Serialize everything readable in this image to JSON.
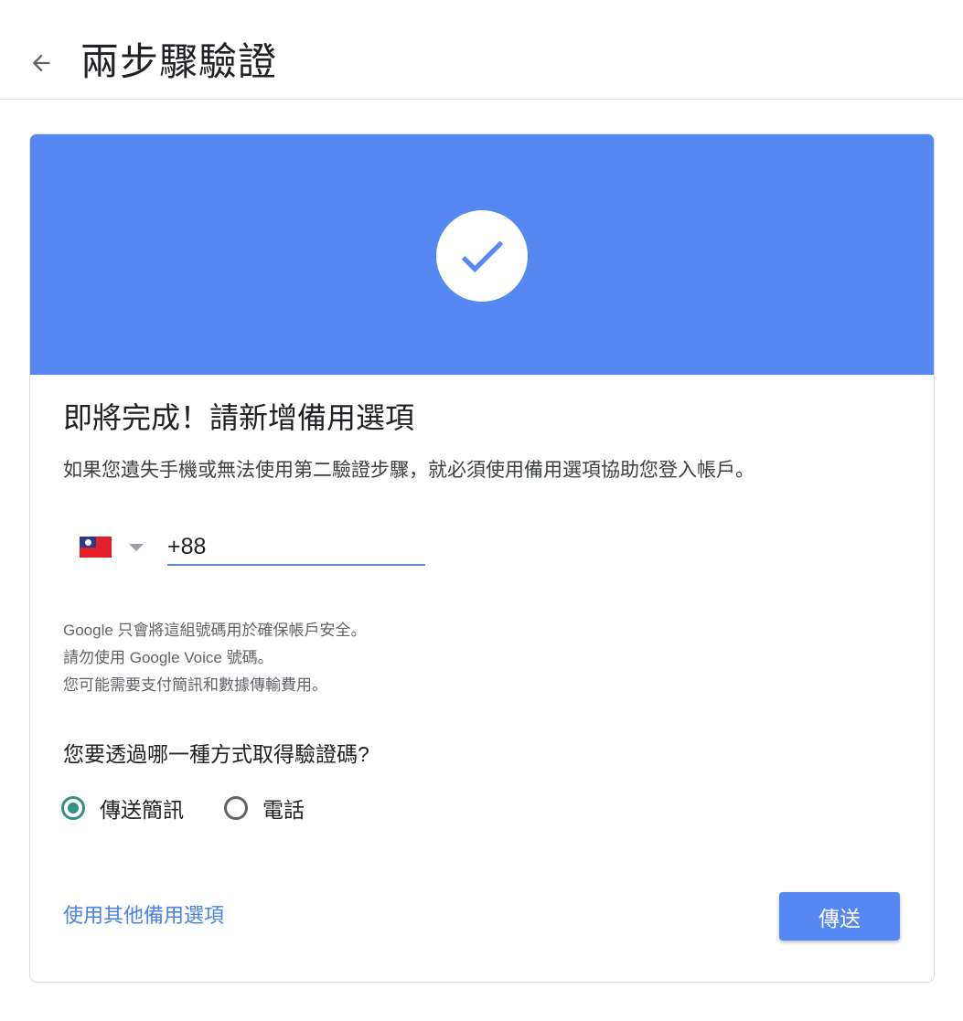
{
  "header": {
    "back_icon": "arrow-left-icon",
    "title": "兩步驟驗證"
  },
  "banner": {
    "color": "#5588f2",
    "icon": "check-circle-icon"
  },
  "card": {
    "heading": "即將完成！請新增備用選項",
    "description": "如果您遺失手機或無法使用第二驗證步驟，就必須使用備用選項協助您登入帳戶。"
  },
  "phone": {
    "country_flag": "taiwan-flag-icon",
    "dropdown_icon": "triangle-down-icon",
    "value": "+88"
  },
  "notes": [
    "Google 只會將這組號碼用於確保帳戶安全。",
    "請勿使用 Google Voice 號碼。",
    "您可能需要支付簡訊和數據傳輸費用。"
  ],
  "method": {
    "question": "您要透過哪一種方式取得驗證碼?",
    "options": [
      {
        "label": "傳送簡訊",
        "selected": true
      },
      {
        "label": "電話",
        "selected": false
      }
    ],
    "selected_color": "#33917e"
  },
  "actions": {
    "other_options_link": "使用其他備用選項",
    "send_button": "傳送",
    "accent": "#4a80e8"
  }
}
